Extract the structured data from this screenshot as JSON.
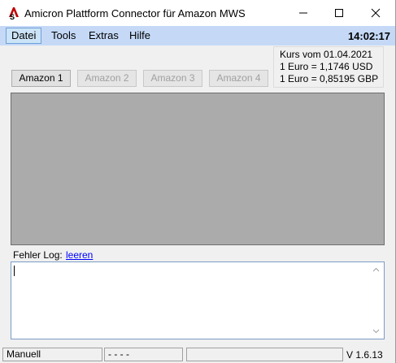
{
  "window": {
    "title": "Amicron Plattform Connector für Amazon MWS"
  },
  "menu": {
    "items": [
      {
        "label": "Datei"
      },
      {
        "label": "Tools"
      },
      {
        "label": "Extras"
      },
      {
        "label": "Hilfe"
      }
    ],
    "clock": "14:02:17"
  },
  "rates": {
    "date_line": "Kurs vom 01.04.2021",
    "usd_line": "1 Euro = 1,1746 USD",
    "gbp_line": "1 Euro = 0,85195 GBP"
  },
  "tabs": [
    {
      "label": "Amazon 1"
    },
    {
      "label": "Amazon 2"
    },
    {
      "label": "Amazon 3"
    },
    {
      "label": "Amazon 4"
    }
  ],
  "log": {
    "label": "Fehler Log:",
    "clear_link": "leeren",
    "content": ""
  },
  "status": {
    "mode": "Manuell",
    "indicator": "- - - -",
    "message": "",
    "version": "V 1.6.13"
  },
  "colors": {
    "menubar": "#c5d9f7",
    "panel": "#ababab",
    "link": "#0000ff"
  },
  "icons": {
    "app": "amicron-logo-icon",
    "minimize": "minimize-icon",
    "maximize": "maximize-icon",
    "close": "close-icon"
  }
}
